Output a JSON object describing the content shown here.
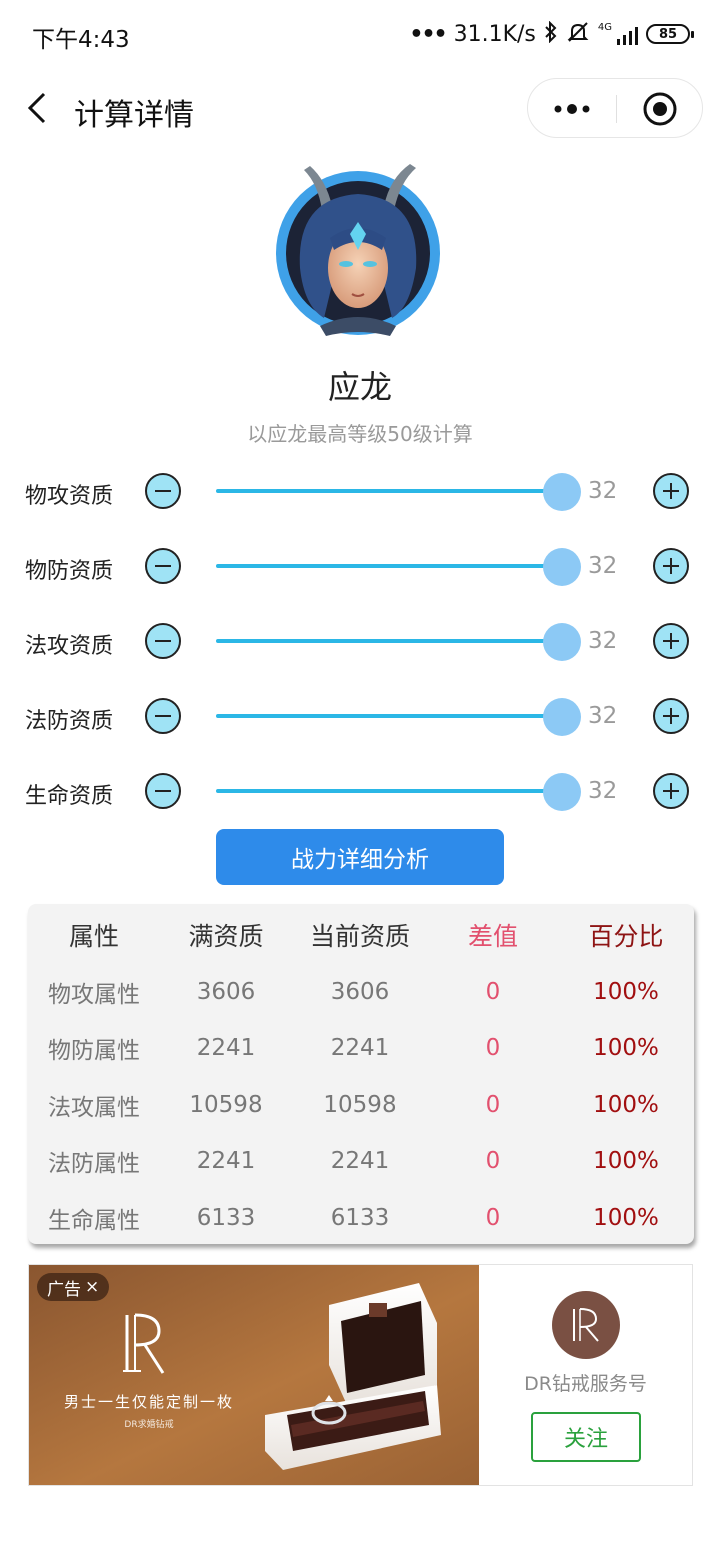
{
  "status_bar": {
    "time": "下午4:43",
    "dots": "•••",
    "network_speed": "31.1K/s",
    "network_type": "4G",
    "battery": "85",
    "icons": [
      "bluetooth-icon",
      "mute-icon",
      "signal-icon",
      "battery-icon"
    ]
  },
  "nav": {
    "title": "计算详情",
    "back_icon": "chevron-left-icon",
    "menu_icon": "more-dots-icon",
    "close_icon": "target-icon"
  },
  "hero": {
    "name": "应龙",
    "subtitle": "以应龙最高等级50级计算"
  },
  "stats": [
    {
      "label": "物攻资质",
      "value": "32",
      "level": 1.0
    },
    {
      "label": "物防资质",
      "value": "32",
      "level": 1.0
    },
    {
      "label": "法攻资质",
      "value": "32",
      "level": 1.0
    },
    {
      "label": "法防资质",
      "value": "32",
      "level": 1.0
    },
    {
      "label": "生命资质",
      "value": "32",
      "level": 1.0
    }
  ],
  "analyze_button": "战力详细分析",
  "table": {
    "headers": [
      "属性",
      "满资质",
      "当前资质",
      "差值",
      "百分比"
    ],
    "rows": [
      [
        "物攻属性",
        "3606",
        "3606",
        "0",
        "100%"
      ],
      [
        "物防属性",
        "2241",
        "2241",
        "0",
        "100%"
      ],
      [
        "法攻属性",
        "10598",
        "10598",
        "0",
        "100%"
      ],
      [
        "法防属性",
        "2241",
        "2241",
        "0",
        "100%"
      ],
      [
        "生命属性",
        "6133",
        "6133",
        "0",
        "100%"
      ]
    ]
  },
  "ad": {
    "tag": "广告",
    "tag_close": "×",
    "logo_text": "DR",
    "slogan": "男士一生仅能定制一枚",
    "slogan_sub": "DR求婚钻戒",
    "brand_name": "DR钻戒服务号",
    "follow": "关注"
  },
  "colors": {
    "accent_blue": "#2e8bea",
    "slider_track": "#2bb7e6",
    "slider_thumb": "#8cc9f5",
    "diff_red": "#e2506e",
    "percent_red": "#a10f10",
    "follow_green": "#2aa13d"
  }
}
